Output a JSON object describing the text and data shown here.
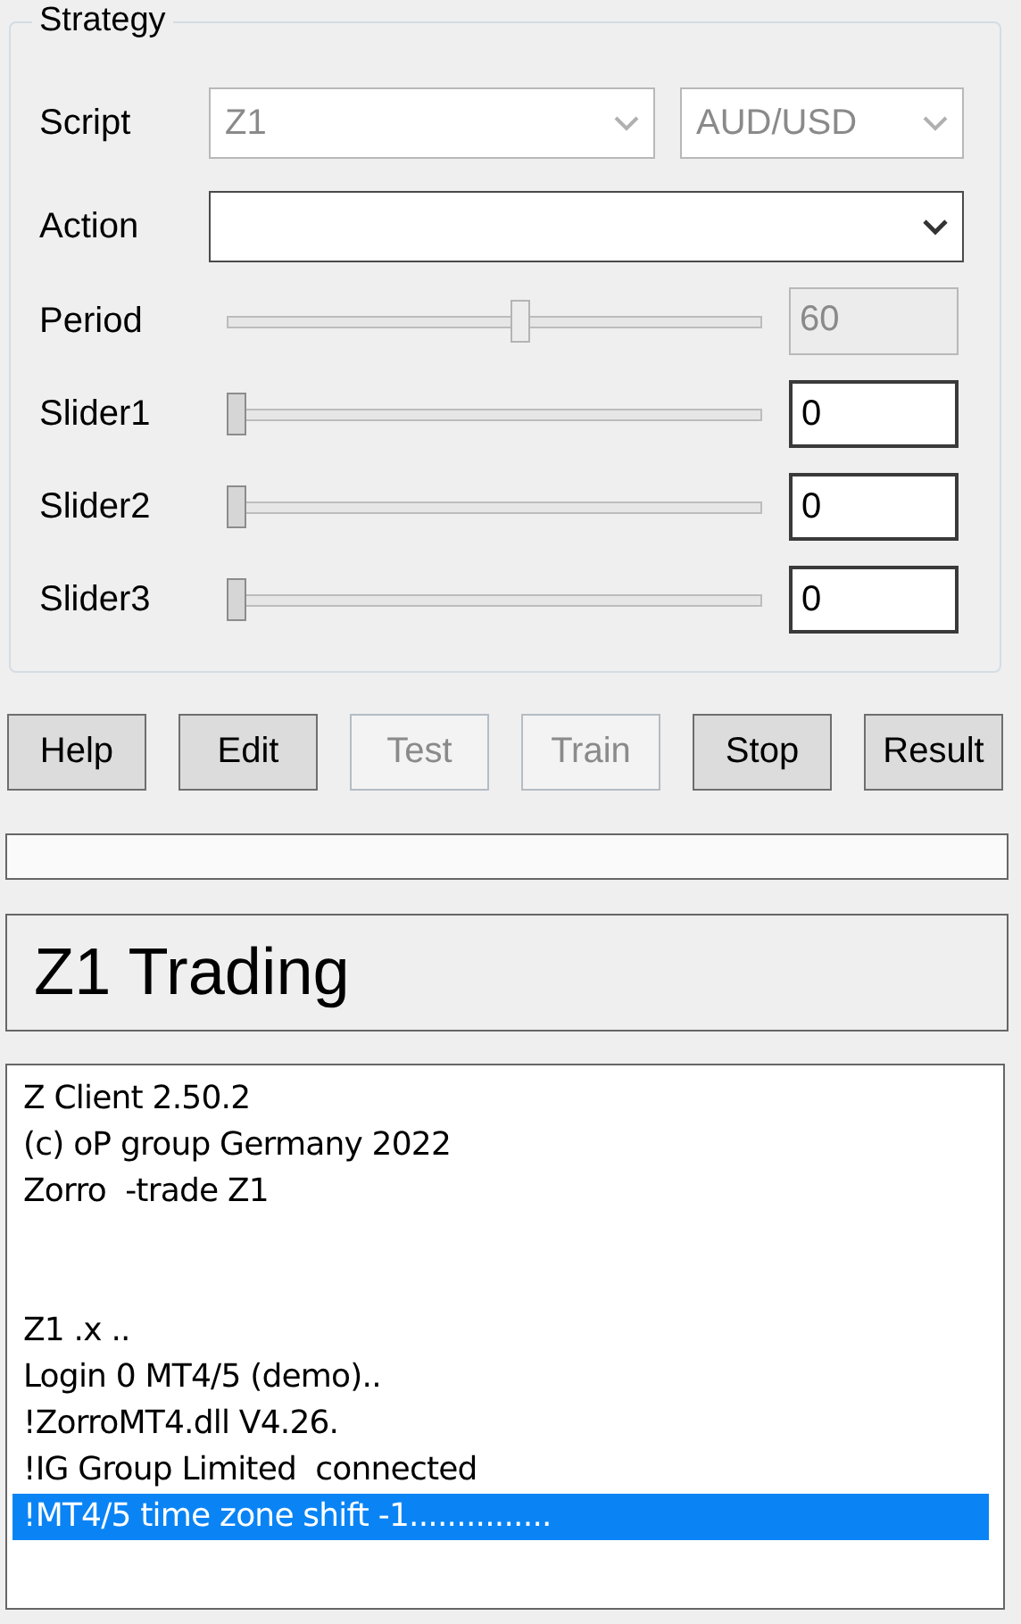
{
  "strategy": {
    "title": "Strategy",
    "script": {
      "label": "Script",
      "value": "Z1",
      "disabled": true
    },
    "asset": {
      "value": "AUD/USD",
      "disabled": true
    },
    "action": {
      "label": "Action",
      "disabled": false
    },
    "sliders": [
      {
        "label": "Period",
        "level": 0.55,
        "value": "60",
        "disabled": true
      },
      {
        "label": "Slider1",
        "level": 0,
        "value": "0",
        "disabled": false
      },
      {
        "label": "Slider2",
        "level": 0,
        "value": "0",
        "disabled": false
      },
      {
        "label": "Slider3",
        "level": 0,
        "value": "0",
        "disabled": false
      }
    ]
  },
  "buttons": [
    {
      "label": "Help",
      "disabled": false
    },
    {
      "label": "Edit",
      "disabled": false
    },
    {
      "label": "Test",
      "disabled": true
    },
    {
      "label": "Train",
      "disabled": true
    },
    {
      "label": "Stop",
      "disabled": false
    },
    {
      "label": "Result",
      "disabled": false
    }
  ],
  "progress": {
    "level": 0
  },
  "status_title": "Z1 Trading",
  "log_blocks": [
    {
      "lines": [
        {
          "text": "Z Client 2.50.2",
          "selected": false
        },
        {
          "text": "(c) oP group Germany 2022",
          "selected": false
        },
        {
          "text": "Zorro  -trade Z1",
          "selected": false
        }
      ]
    },
    {
      "lines": [
        {
          "text": "Z1 .x ..",
          "selected": false
        },
        {
          "text": "Login 0 MT4/5 (demo)..",
          "selected": false
        },
        {
          "text": "!ZorroMT4.dll V4.26.",
          "selected": false
        },
        {
          "text": "!IG Group Limited  connected",
          "selected": false
        },
        {
          "text": "!MT4/5 time zone shift -1...............",
          "selected": true
        }
      ]
    }
  ]
}
